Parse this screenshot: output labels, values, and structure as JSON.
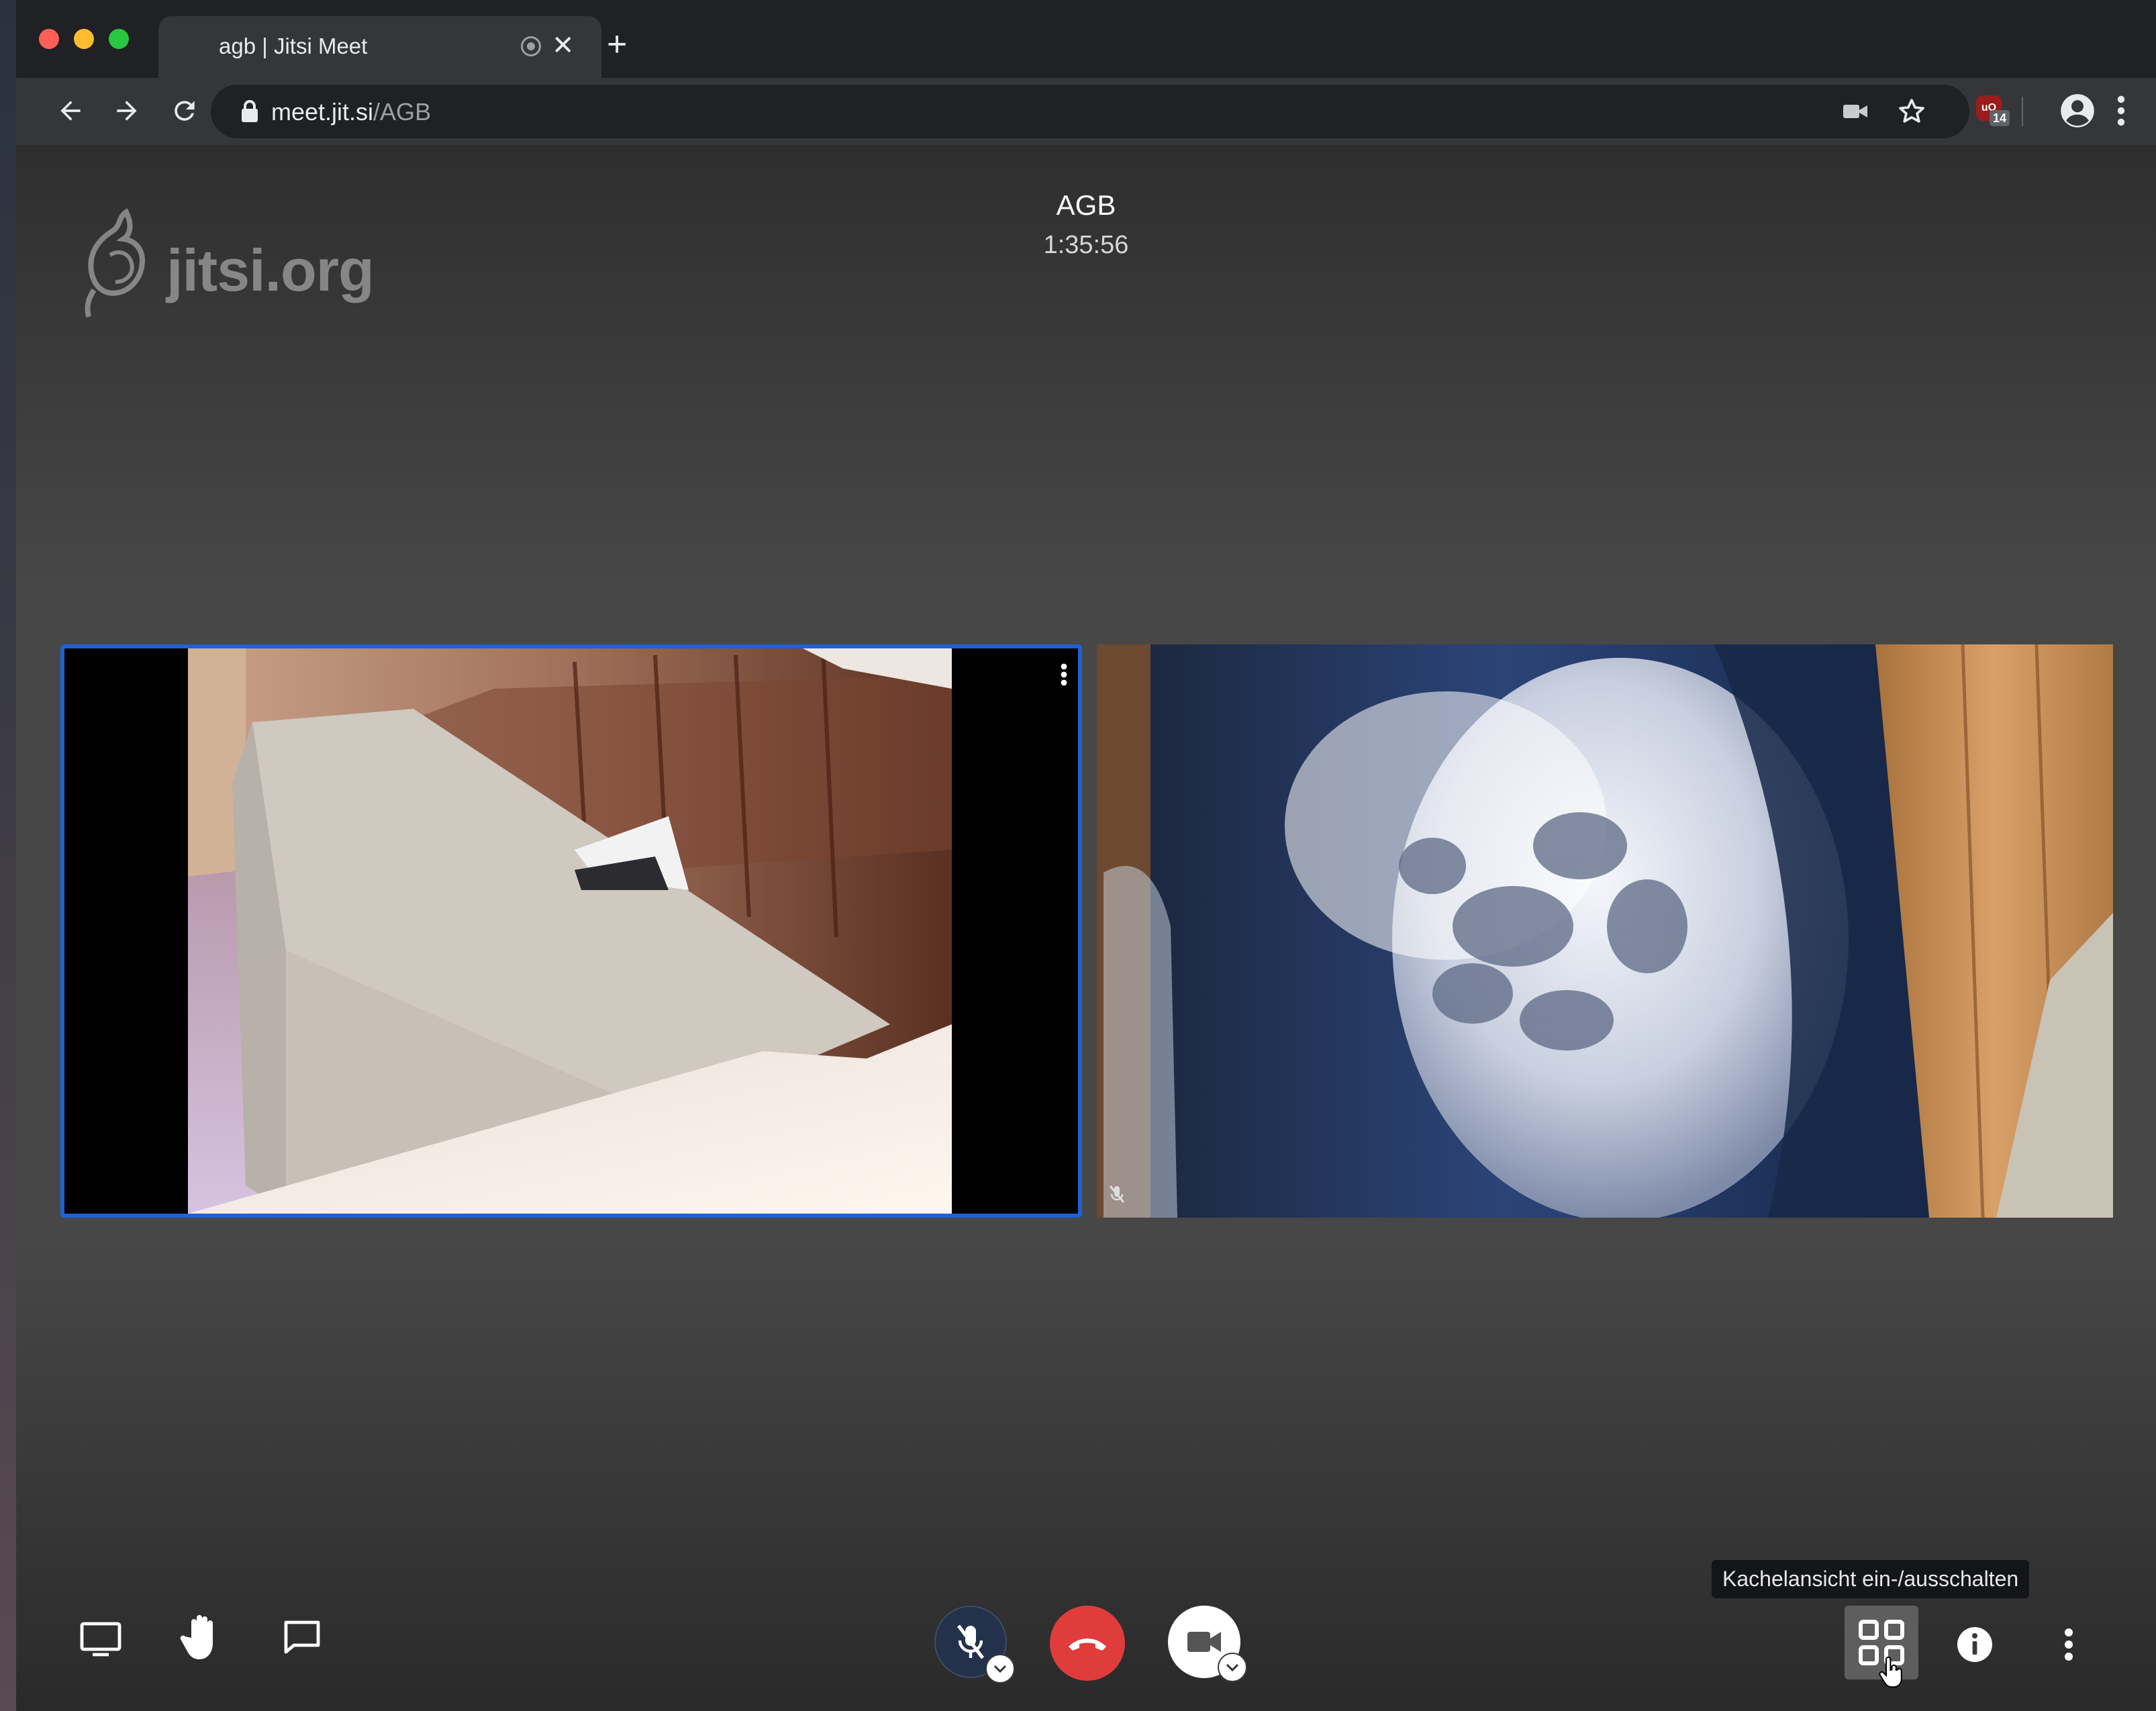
{
  "browser": {
    "tab": {
      "title": "agb | Jitsi Meet"
    },
    "address": {
      "host": "meet.jit.si",
      "path": "/AGB"
    },
    "extension_badge": "14",
    "extension_label": "uO"
  },
  "meeting": {
    "logo_text": "jitsi.org",
    "room_name": "AGB",
    "timer": "1:35:56"
  },
  "toolbox": {
    "tooltip": "Kachelansicht ein-/ausschalten"
  },
  "colors": {
    "hangup": "#e03c3c",
    "active_border": "#1d62d6",
    "toolbar_bg": "#35363a"
  },
  "icons": {
    "screen_share": "monitor-icon",
    "raise_hand": "hand-icon",
    "chat": "chat-bubble-icon",
    "microphone": "microphone-muted-icon",
    "hangup": "phone-hangup-icon",
    "camera": "video-camera-icon",
    "tile_view": "tile-grid-icon",
    "info": "info-icon",
    "more": "more-vertical-icon"
  }
}
